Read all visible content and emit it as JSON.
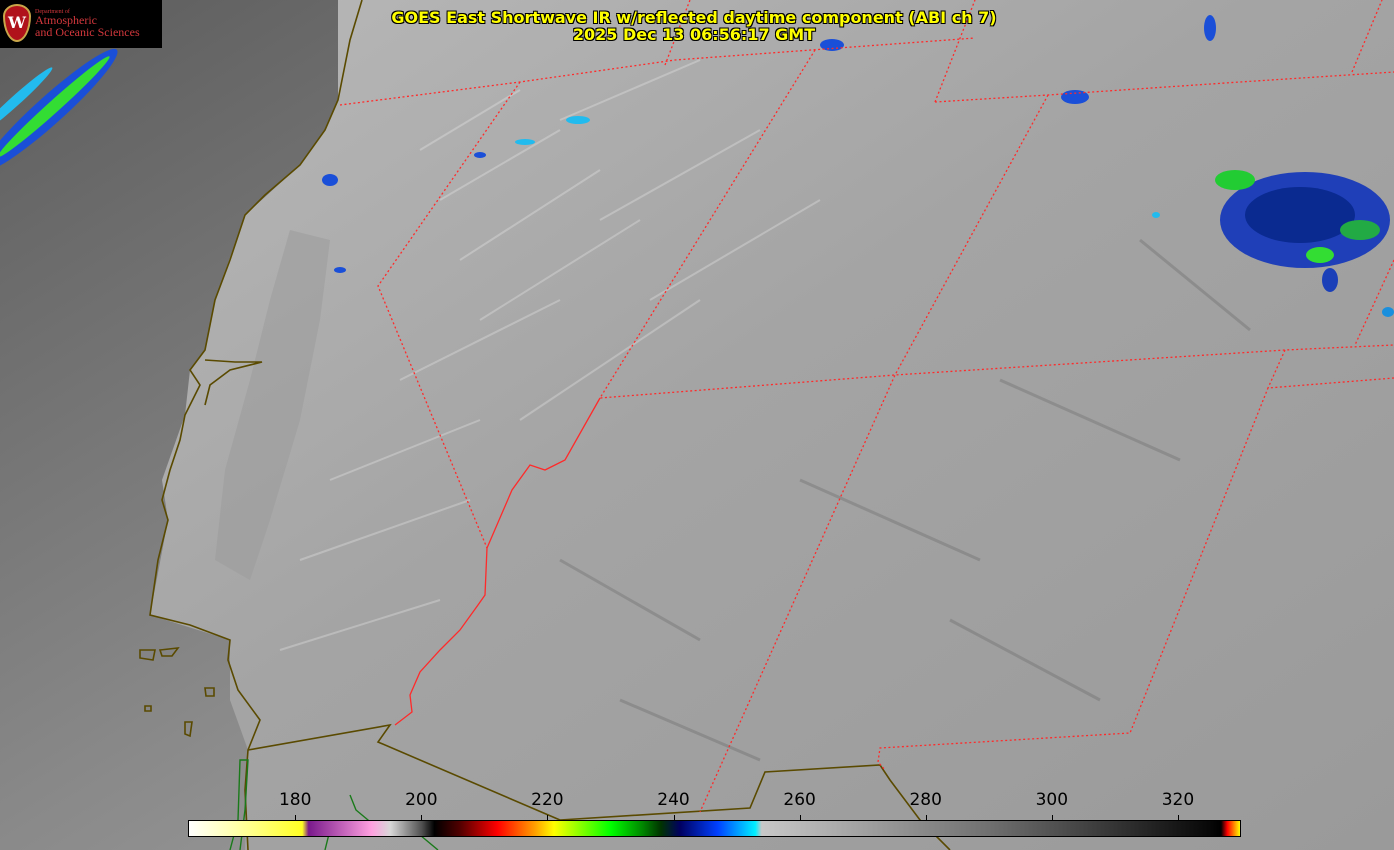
{
  "title": {
    "line1": "GOES East Shortwave IR w/reflected daytime component (ABI ch 7)",
    "line2": "2025 Dec 13 06:56:17 GMT"
  },
  "logo": {
    "dept": "Department of",
    "line1": "Atmospheric",
    "line2": "and Oceanic Sciences"
  },
  "colorbar": {
    "min": 163,
    "max": 330,
    "ticks": [
      180,
      200,
      220,
      240,
      260,
      280,
      300,
      320
    ],
    "tick_labels": [
      "180",
      "200",
      "220",
      "240",
      "260",
      "280",
      "300",
      "320"
    ],
    "stops": [
      {
        "t": 163,
        "c": "#ffffff"
      },
      {
        "t": 170,
        "c": "#ffffb0"
      },
      {
        "t": 181,
        "c": "#ffff22"
      },
      {
        "t": 182,
        "c": "#7a1a8c"
      },
      {
        "t": 192,
        "c": "#ffa0e0"
      },
      {
        "t": 195,
        "c": "#d8d8d8"
      },
      {
        "t": 200,
        "c": "#505050"
      },
      {
        "t": 202,
        "c": "#000000"
      },
      {
        "t": 206,
        "c": "#500000"
      },
      {
        "t": 212,
        "c": "#ff0000"
      },
      {
        "t": 218,
        "c": "#ffa000"
      },
      {
        "t": 221,
        "c": "#ffff00"
      },
      {
        "t": 230,
        "c": "#00ff00"
      },
      {
        "t": 235,
        "c": "#008800"
      },
      {
        "t": 238,
        "c": "#003300"
      },
      {
        "t": 241,
        "c": "#000060"
      },
      {
        "t": 247,
        "c": "#0040ff"
      },
      {
        "t": 253,
        "c": "#00f0ff"
      },
      {
        "t": 254,
        "c": "#c8c8c8"
      },
      {
        "t": 290,
        "c": "#707070"
      },
      {
        "t": 325,
        "c": "#080808"
      },
      {
        "t": 327,
        "c": "#000000"
      },
      {
        "t": 328,
        "c": "#ff0000"
      },
      {
        "t": 330,
        "c": "#ffff00"
      }
    ]
  },
  "colors": {
    "title_text": "#ffff00",
    "borders": "#ff2a2a",
    "coastline": "#5a4a00",
    "logo_text": "#d2373c",
    "background": "#000000"
  }
}
